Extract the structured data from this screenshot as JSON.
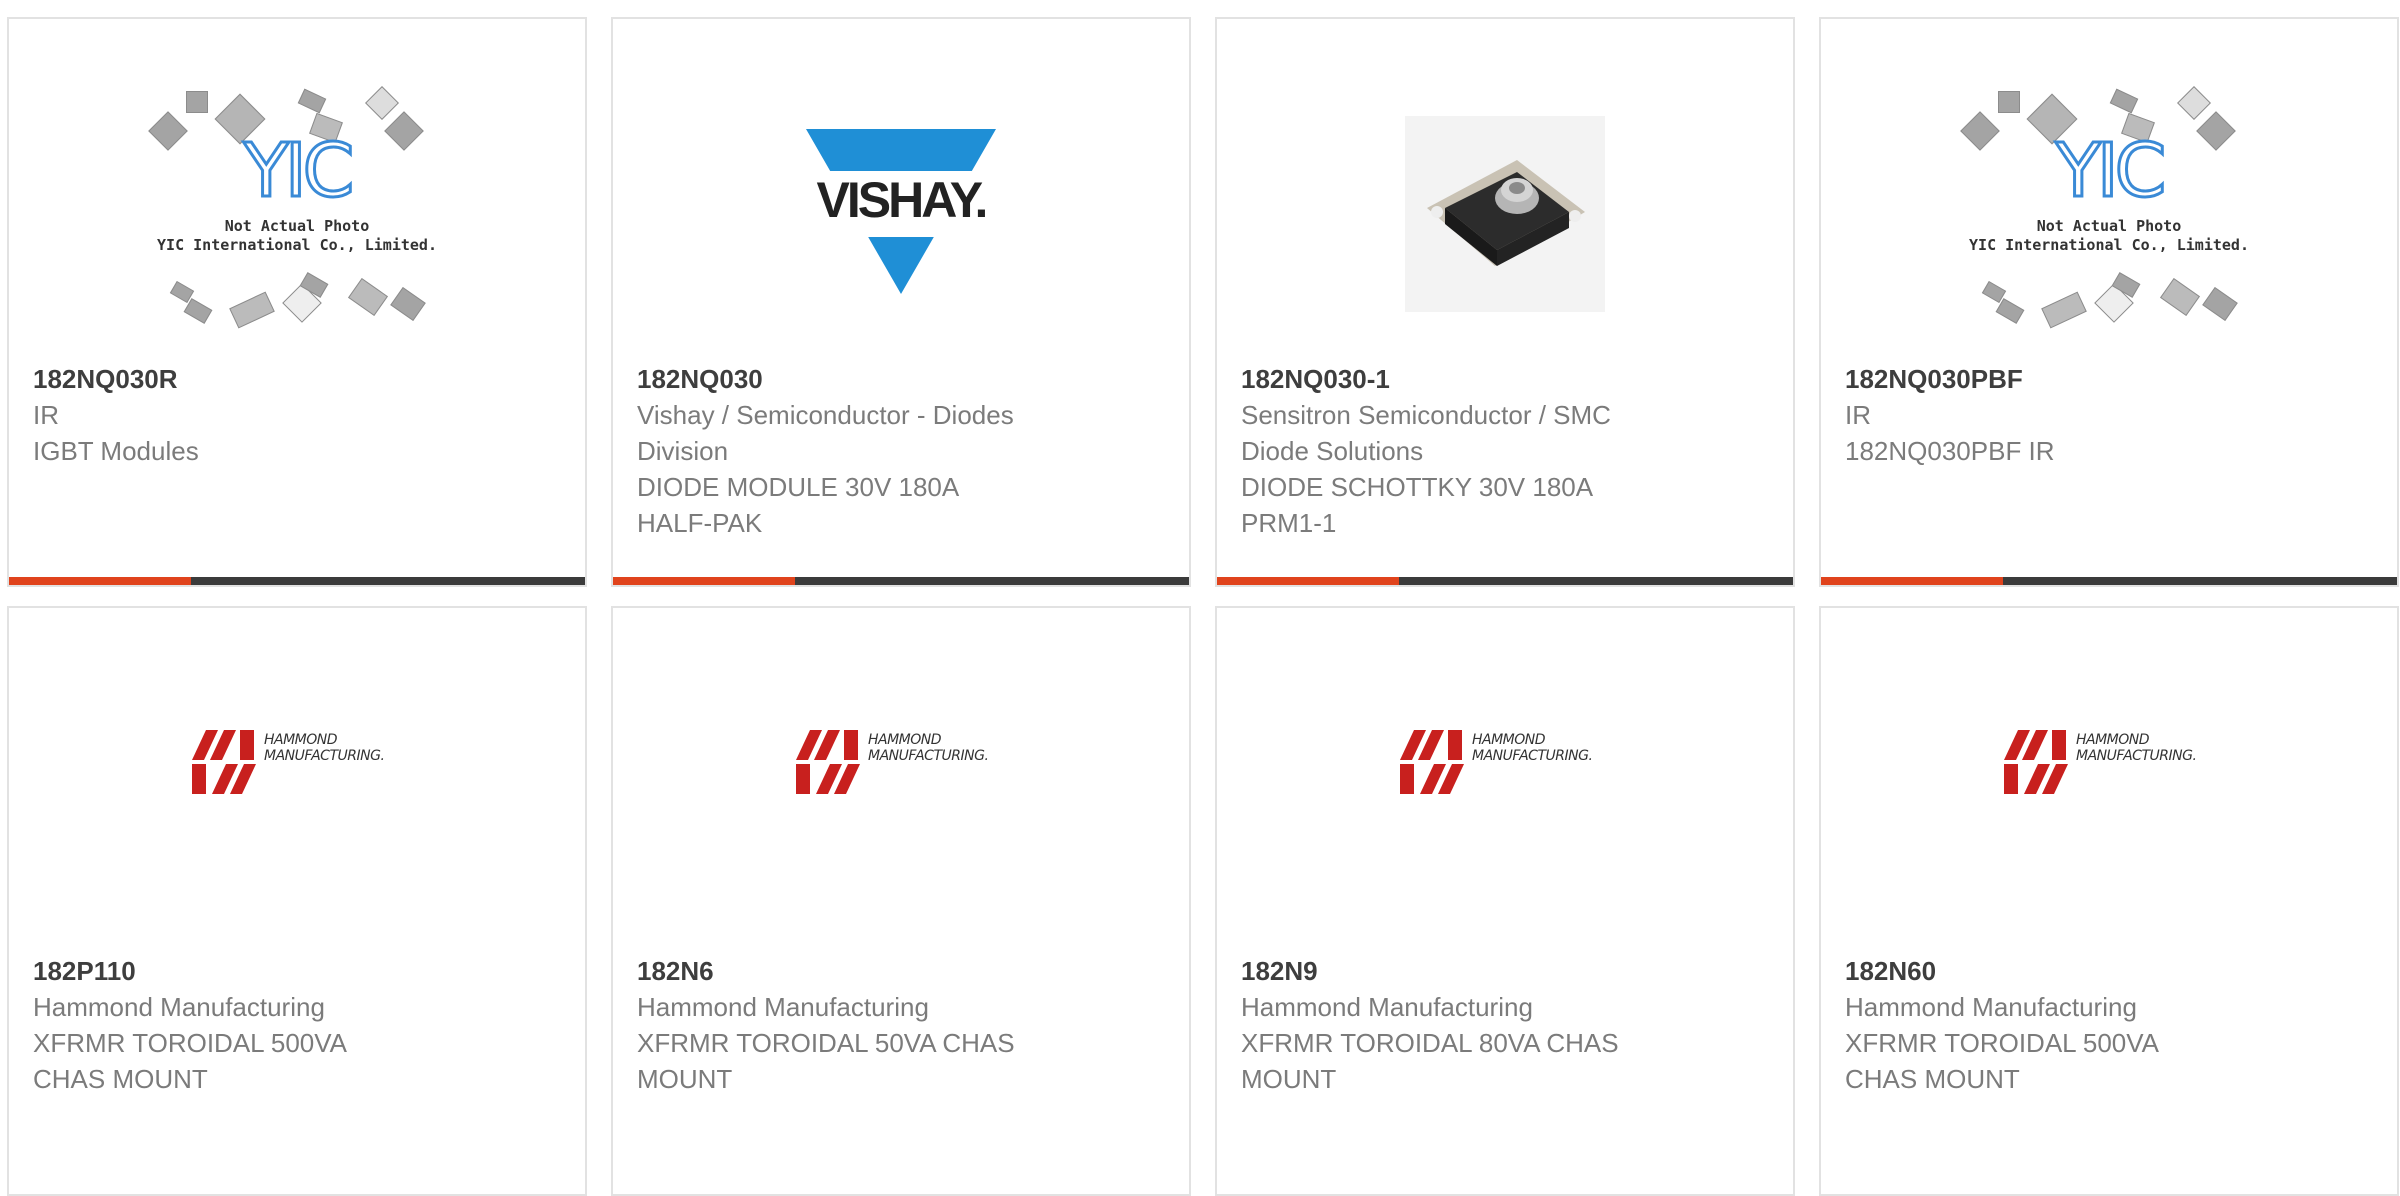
{
  "brand_colors": {
    "accent": "#e0431c",
    "bar": "#3b3b3b",
    "vishay_blue": "#1f8fd6",
    "hammond_red": "#c8201e"
  },
  "products": [
    {
      "part": "182NQ030R",
      "lines": [
        "IR",
        "IGBT Modules"
      ],
      "image": "yic-not-actual-photo",
      "image_caption": [
        "Not Actual Photo",
        "YIC International Co., Limited."
      ],
      "image_logo": "YIC"
    },
    {
      "part": "182NQ030",
      "lines": [
        "Vishay / Semiconductor - Diodes",
        "Division",
        "DIODE MODULE 30V 180A",
        "HALF-PAK"
      ],
      "image": "vishay-logo",
      "image_logo": "VISHAY."
    },
    {
      "part": "182NQ030-1",
      "lines": [
        "Sensitron Semiconductor / SMC",
        "Diode Solutions",
        "DIODE SCHOTTKY 30V 180A",
        "PRM1-1"
      ],
      "image": "diode-module-photo"
    },
    {
      "part": "182NQ030PBF",
      "lines": [
        "IR",
        "182NQ030PBF IR"
      ],
      "image": "yic-not-actual-photo",
      "image_caption": [
        "Not Actual Photo",
        "YIC International Co., Limited."
      ],
      "image_logo": "YIC"
    },
    {
      "part": "182P110",
      "lines": [
        "Hammond Manufacturing",
        "XFRMR TOROIDAL 500VA",
        "CHAS MOUNT"
      ],
      "image": "hammond-logo",
      "image_logo": [
        "HAMMOND",
        "MANUFACTURING."
      ]
    },
    {
      "part": "182N6",
      "lines": [
        "Hammond Manufacturing",
        "XFRMR TOROIDAL 50VA CHAS",
        "MOUNT"
      ],
      "image": "hammond-logo",
      "image_logo": [
        "HAMMOND",
        "MANUFACTURING."
      ]
    },
    {
      "part": "182N9",
      "lines": [
        "Hammond Manufacturing",
        "XFRMR TOROIDAL 80VA CHAS",
        "MOUNT"
      ],
      "image": "hammond-logo",
      "image_logo": [
        "HAMMOND",
        "MANUFACTURING."
      ]
    },
    {
      "part": "182N60",
      "lines": [
        "Hammond Manufacturing",
        "XFRMR TOROIDAL 500VA",
        "CHAS MOUNT"
      ],
      "image": "hammond-logo",
      "image_logo": [
        "HAMMOND",
        "MANUFACTURING."
      ]
    }
  ]
}
